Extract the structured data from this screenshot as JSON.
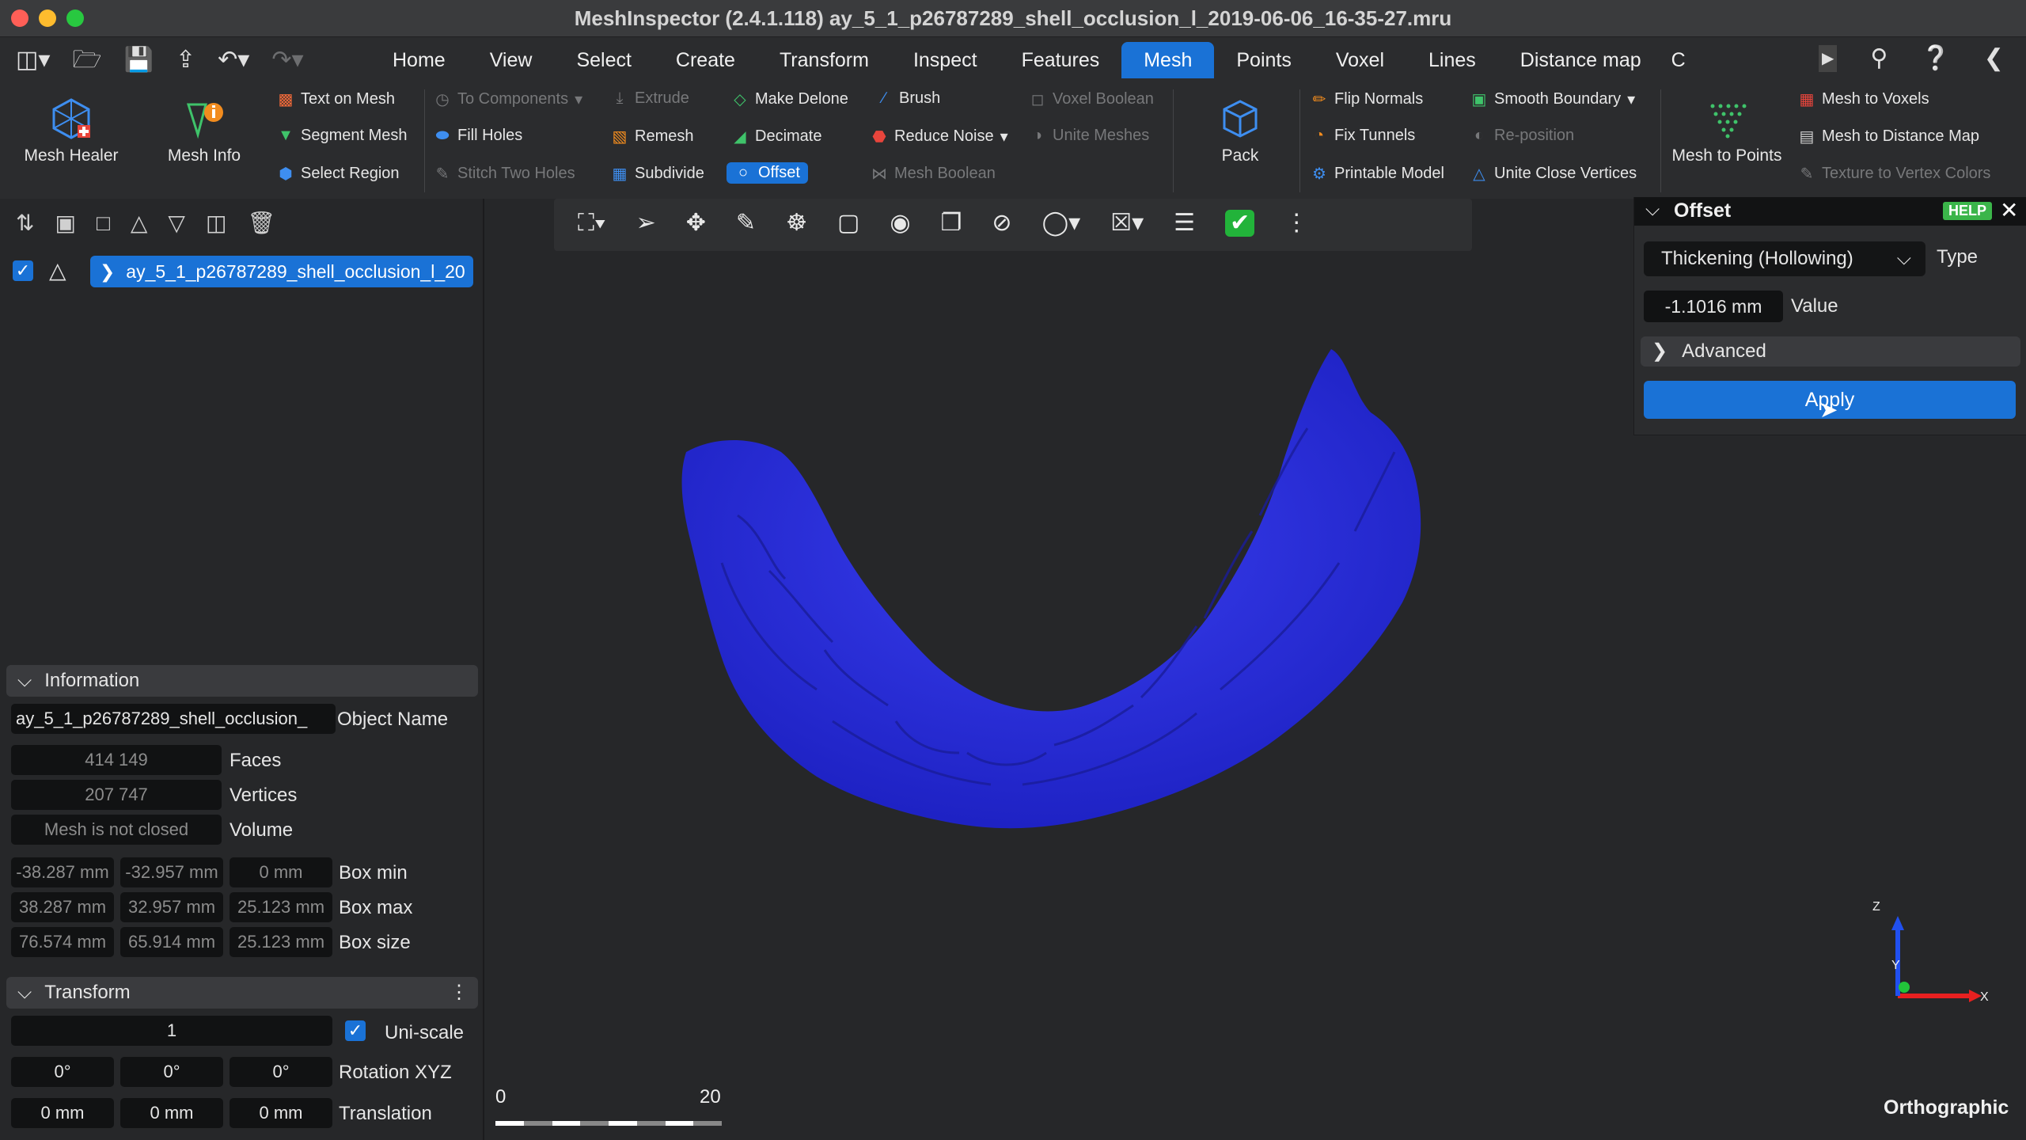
{
  "window": {
    "title": "MeshInspector (2.4.1.118) ay_5_1_p26787289_shell_occlusion_l_2019-06-06_16-35-27.mru"
  },
  "menu": {
    "tabs": [
      "Home",
      "View",
      "Select",
      "Create",
      "Transform",
      "Inspect",
      "Features",
      "Mesh",
      "Points",
      "Voxel",
      "Lines",
      "Distance map",
      "C"
    ],
    "active_tab": "Mesh"
  },
  "ribbon": {
    "mesh_healer": "Mesh Healer",
    "mesh_info": "Mesh Info",
    "text_on_mesh": "Text on Mesh",
    "segment_mesh": "Segment Mesh",
    "select_region": "Select Region",
    "to_components": "To Components",
    "fill_holes": "Fill Holes",
    "stitch_two_holes": "Stitch Two Holes",
    "extrude": "Extrude",
    "remesh": "Remesh",
    "subdivide": "Subdivide",
    "make_delone": "Make Delone",
    "decimate": "Decimate",
    "offset": "Offset",
    "brush": "Brush",
    "reduce_noise": "Reduce Noise",
    "mesh_boolean": "Mesh Boolean",
    "voxel_boolean": "Voxel Boolean",
    "unite_meshes": "Unite Meshes",
    "pack": "Pack",
    "flip_normals": "Flip Normals",
    "fix_tunnels": "Fix Tunnels",
    "printable_model": "Printable Model",
    "smooth_boundary": "Smooth Boundary",
    "re_position": "Re-position",
    "unite_close_vertices": "Unite Close Vertices",
    "mesh_to_points": "Mesh to Points",
    "mesh_to_voxels": "Mesh to Voxels",
    "mesh_to_distance_map": "Mesh to Distance Map",
    "texture_to_vertex_colors": "Texture to Vertex Colors"
  },
  "scene": {
    "object_name": "ay_5_1_p26787289_shell_occlusion_l_20"
  },
  "information": {
    "header": "Information",
    "object_name_value": "ay_5_1_p26787289_shell_occlusion_",
    "object_name_label": "Object Name",
    "faces_value": "414 149",
    "faces_label": "Faces",
    "vertices_value": "207 747",
    "vertices_label": "Vertices",
    "volume_value": "Mesh is not closed",
    "volume_label": "Volume",
    "box_min": [
      "-38.287 mm",
      "-32.957 mm",
      "0 mm"
    ],
    "box_min_label": "Box min",
    "box_max": [
      "38.287 mm",
      "32.957 mm",
      "25.123 mm"
    ],
    "box_max_label": "Box max",
    "box_size": [
      "76.574 mm",
      "65.914 mm",
      "25.123 mm"
    ],
    "box_size_label": "Box size"
  },
  "transform": {
    "header": "Transform",
    "scale_value": "1",
    "uniscale_label": "Uni-scale",
    "rotation": [
      "0°",
      "0°",
      "0°"
    ],
    "rotation_label": "Rotation XYZ",
    "translation": [
      "0 mm",
      "0 mm",
      "0 mm"
    ],
    "translation_label": "Translation"
  },
  "offset_panel": {
    "title": "Offset",
    "help": "HELP",
    "type_value": "Thickening (Hollowing)",
    "type_label": "Type",
    "value": "-1.1016 mm",
    "value_label": "Value",
    "advanced": "Advanced",
    "apply": "Apply"
  },
  "viewport": {
    "scale_start": "0",
    "scale_end": "20",
    "projection": "Orthographic",
    "axis_x": "X",
    "axis_y": "Y",
    "axis_z": "Z",
    "mesh_color": "#2a2ee0"
  }
}
